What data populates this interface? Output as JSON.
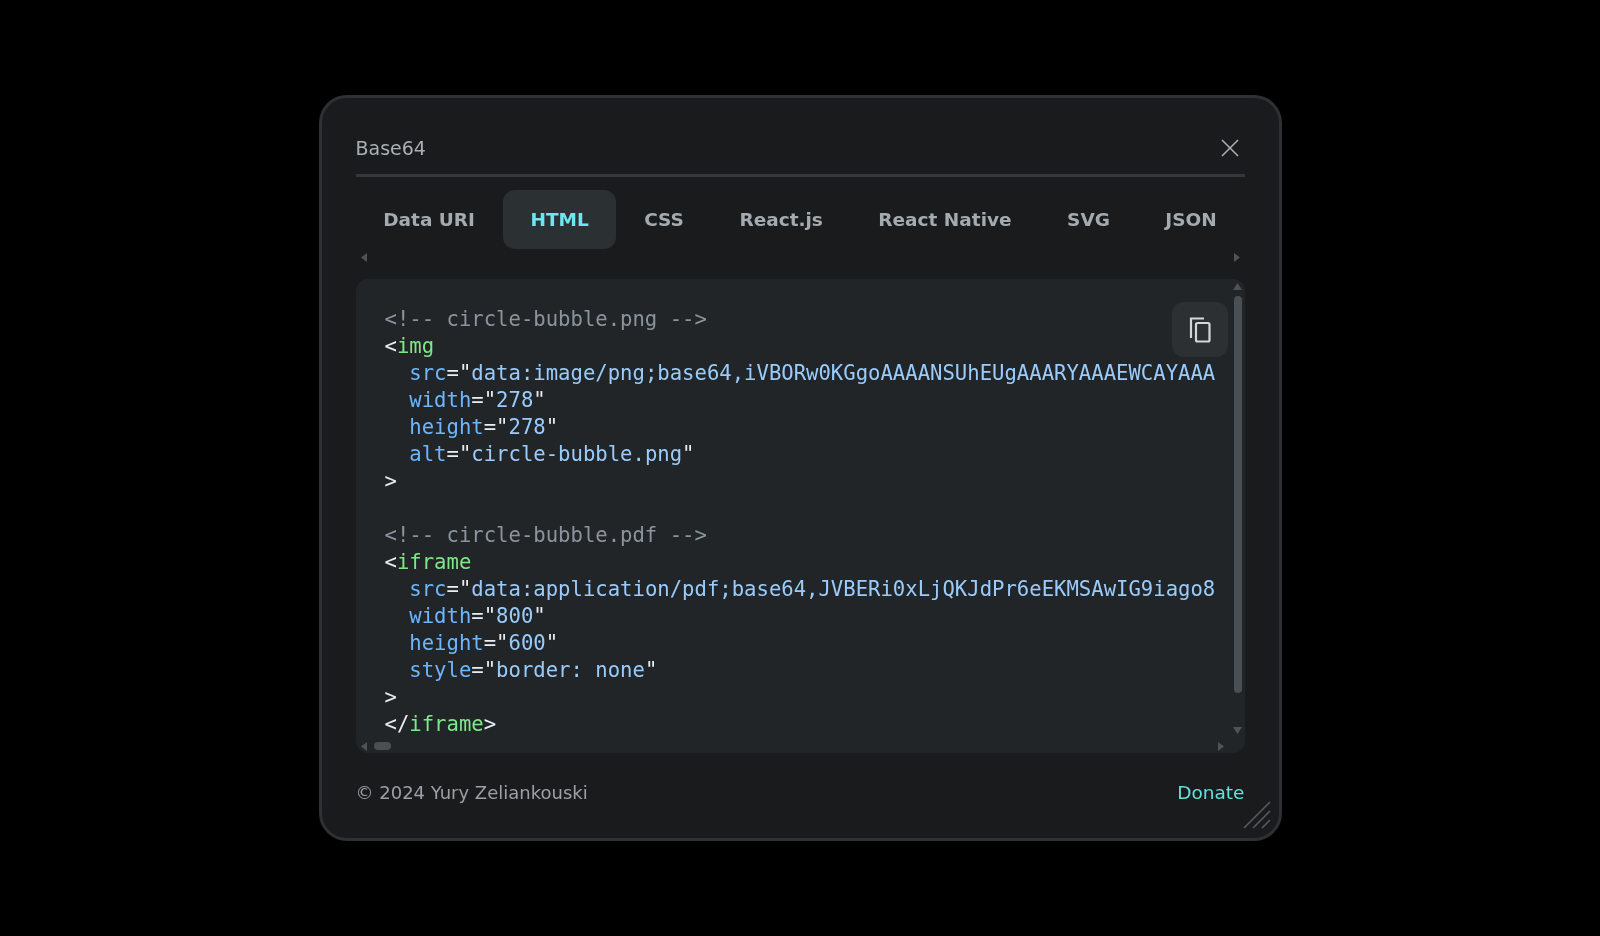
{
  "dialog": {
    "title": "Base64",
    "tabs": [
      {
        "label": "Data URI",
        "selected": false
      },
      {
        "label": "HTML",
        "selected": true
      },
      {
        "label": "CSS",
        "selected": false
      },
      {
        "label": "React.js",
        "selected": false
      },
      {
        "label": "React Native",
        "selected": false
      },
      {
        "label": "SVG",
        "selected": false
      },
      {
        "label": "JSON",
        "selected": false
      }
    ],
    "code": {
      "blocks": [
        {
          "lines": [
            {
              "tokens": [
                {
                  "kind": "comment",
                  "text": "<!-- circle-bubble.png -->"
                }
              ]
            },
            {
              "tokens": [
                {
                  "kind": "punct",
                  "text": "<"
                },
                {
                  "kind": "tag",
                  "text": "img"
                }
              ],
              "children": [
                {
                  "tokens": [
                    {
                      "kind": "attr",
                      "text": "src"
                    },
                    {
                      "kind": "punct",
                      "text": "=\""
                    },
                    {
                      "kind": "string",
                      "text": "data:image/png;base64,iVBORw0KGgoAAAANSUhEUgAAARYAAAEWCAYAAA"
                    }
                  ]
                },
                {
                  "tokens": [
                    {
                      "kind": "attr",
                      "text": "width"
                    },
                    {
                      "kind": "punct",
                      "text": "=\""
                    },
                    {
                      "kind": "string",
                      "text": "278"
                    },
                    {
                      "kind": "punct",
                      "text": "\""
                    }
                  ]
                },
                {
                  "tokens": [
                    {
                      "kind": "attr",
                      "text": "height"
                    },
                    {
                      "kind": "punct",
                      "text": "=\""
                    },
                    {
                      "kind": "string",
                      "text": "278"
                    },
                    {
                      "kind": "punct",
                      "text": "\""
                    }
                  ]
                },
                {
                  "tokens": [
                    {
                      "kind": "attr",
                      "text": "alt"
                    },
                    {
                      "kind": "punct",
                      "text": "=\""
                    },
                    {
                      "kind": "string",
                      "text": "circle-bubble.png"
                    },
                    {
                      "kind": "punct",
                      "text": "\""
                    }
                  ]
                }
              ]
            },
            {
              "tokens": [
                {
                  "kind": "punct",
                  "text": ">"
                }
              ]
            }
          ]
        },
        {
          "lines": [
            {
              "tokens": [
                {
                  "kind": "comment",
                  "text": "<!-- circle-bubble.pdf -->"
                }
              ]
            },
            {
              "tokens": [
                {
                  "kind": "punct",
                  "text": "<"
                },
                {
                  "kind": "tag",
                  "text": "iframe"
                }
              ],
              "children": [
                {
                  "tokens": [
                    {
                      "kind": "attr",
                      "text": "src"
                    },
                    {
                      "kind": "punct",
                      "text": "=\""
                    },
                    {
                      "kind": "string",
                      "text": "data:application/pdf;base64,JVBERi0xLjQKJdPr6eEKMSAwIG9iago8"
                    }
                  ]
                },
                {
                  "tokens": [
                    {
                      "kind": "attr",
                      "text": "width"
                    },
                    {
                      "kind": "punct",
                      "text": "=\""
                    },
                    {
                      "kind": "string",
                      "text": "800"
                    },
                    {
                      "kind": "punct",
                      "text": "\""
                    }
                  ]
                },
                {
                  "tokens": [
                    {
                      "kind": "attr",
                      "text": "height"
                    },
                    {
                      "kind": "punct",
                      "text": "=\""
                    },
                    {
                      "kind": "string",
                      "text": "600"
                    },
                    {
                      "kind": "punct",
                      "text": "\""
                    }
                  ]
                },
                {
                  "tokens": [
                    {
                      "kind": "attr",
                      "text": "style"
                    },
                    {
                      "kind": "punct",
                      "text": "=\""
                    },
                    {
                      "kind": "string",
                      "text": "border: none"
                    },
                    {
                      "kind": "punct",
                      "text": "\""
                    }
                  ]
                }
              ]
            },
            {
              "tokens": [
                {
                  "kind": "punct",
                  "text": ">"
                }
              ]
            },
            {
              "tokens": [
                {
                  "kind": "punct",
                  "text": "</"
                },
                {
                  "kind": "tag",
                  "text": "iframe"
                },
                {
                  "kind": "punct",
                  "text": ">"
                }
              ]
            }
          ]
        }
      ]
    },
    "footer": {
      "copyright": "© 2024 Yury Zeliankouski",
      "link": "Donate"
    }
  }
}
